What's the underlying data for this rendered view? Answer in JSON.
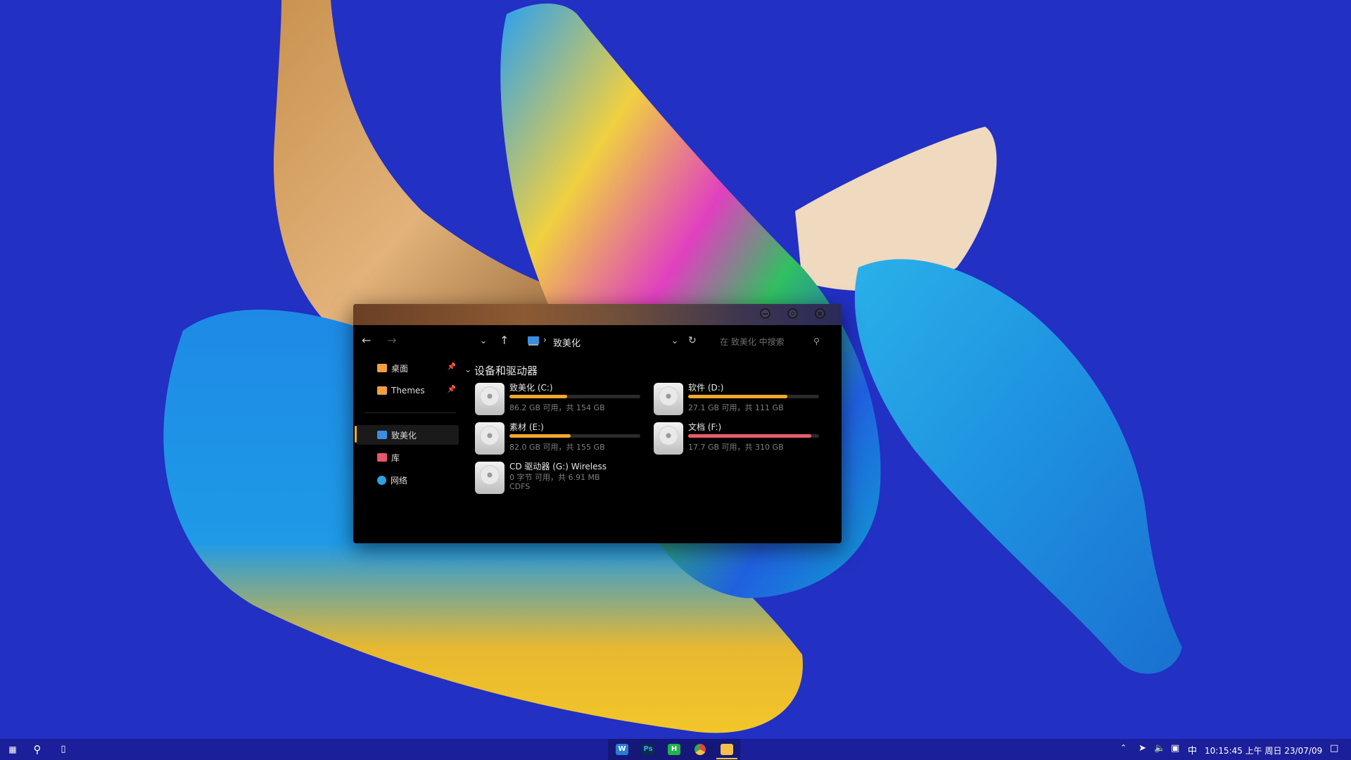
{
  "window": {
    "address_location": "致美化",
    "search_placeholder": "在 致美化 中搜索"
  },
  "sidebar": {
    "items": [
      {
        "label": "桌面",
        "pinned": true,
        "icon": "folder-icon"
      },
      {
        "label": "Themes",
        "pinned": true,
        "icon": "folder-icon"
      },
      {
        "label": "致美化",
        "selected": true,
        "icon": "computer-icon"
      },
      {
        "label": "库",
        "icon": "library-icon"
      },
      {
        "label": "网络",
        "icon": "network-icon"
      }
    ]
  },
  "content": {
    "group_title": "设备和驱动器",
    "drives": [
      {
        "name": "致美化 (C:)",
        "info": "86.2 GB 可用，共 154 GB",
        "used_fraction": 0.44,
        "bar_color": "#f0a830"
      },
      {
        "name": "软件 (D:)",
        "info": "27.1 GB 可用，共 111 GB",
        "used_fraction": 0.76,
        "bar_color": "#f0a830"
      },
      {
        "name": "素材 (E:)",
        "info": "82.0 GB 可用，共 155 GB",
        "used_fraction": 0.47,
        "bar_color": "#f0a830"
      },
      {
        "name": "文档 (F:)",
        "info": "17.7 GB 可用，共 310 GB",
        "used_fraction": 0.94,
        "bar_color": "#e85c6a"
      },
      {
        "name": "CD 驱动器 (G:) Wireless",
        "info": "0 字节 可用，共 6.91 MB",
        "info2": "CDFS"
      }
    ]
  },
  "taskbar": {
    "clock": "10:15:45 上午 周日 23/07/09",
    "ime": "中",
    "apps": [
      {
        "label": "W",
        "color": "#2b7cd3"
      },
      {
        "label": "Ps",
        "color": "#31a8ff"
      },
      {
        "label": "H",
        "color": "#1fb34a"
      },
      {
        "label": "",
        "color": "#e8453c"
      },
      {
        "label": "",
        "color": "#f5c04a"
      }
    ]
  }
}
